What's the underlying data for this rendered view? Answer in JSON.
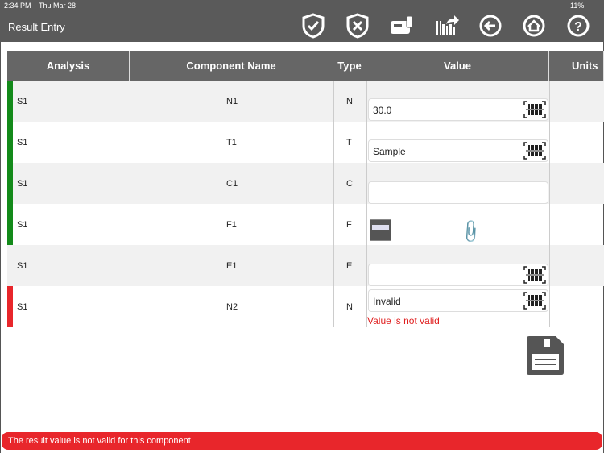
{
  "status_bar": {
    "time": "2:34 PM",
    "date": "Thu Mar 28",
    "battery": "11%"
  },
  "header": {
    "title": "Result Entry"
  },
  "toolbar": [
    "approve-shield-icon",
    "reject-shield-icon",
    "instrument-icon",
    "barcode-export-icon",
    "back-icon",
    "home-icon",
    "help-icon"
  ],
  "table": {
    "columns": [
      "Analysis",
      "Component Name",
      "Type",
      "Value",
      "Units"
    ],
    "rows": [
      {
        "analysis": "S1",
        "component": "N1",
        "type": "N",
        "value": "30.0",
        "flag": "#138a1a"
      },
      {
        "analysis": "S1",
        "component": "T1",
        "type": "T",
        "value": "Sample",
        "flag": "#138a1a"
      },
      {
        "analysis": "S1",
        "component": "C1",
        "type": "C",
        "value": "",
        "flag": "#138a1a"
      },
      {
        "analysis": "S1",
        "component": "F1",
        "type": "F",
        "value": "",
        "flag": "#138a1a"
      },
      {
        "analysis": "S1",
        "component": "E1",
        "type": "E",
        "value": "",
        "flag": ""
      },
      {
        "analysis": "S1",
        "component": "N2",
        "type": "N",
        "value": "Invalid",
        "flag": "#e8262b",
        "error": "Value is not valid"
      }
    ]
  },
  "footer_error": "The result value is not valid for this component",
  "colors": {
    "header": "#5a5a5a",
    "error": "#e8262b",
    "valid": "#138a1a"
  }
}
